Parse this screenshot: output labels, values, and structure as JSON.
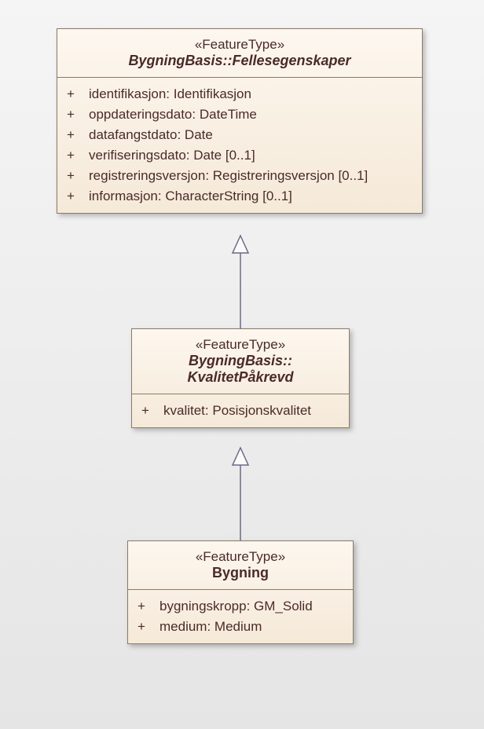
{
  "classes": {
    "fellesegenskaper": {
      "stereotype": "«FeatureType»",
      "name": "BygningBasis::Fellesegenskaper",
      "attributes": [
        {
          "vis": "+",
          "text": "identifikasjon: Identifikasjon"
        },
        {
          "vis": "+",
          "text": "oppdateringsdato: DateTime"
        },
        {
          "vis": "+",
          "text": "datafangstdato: Date"
        },
        {
          "vis": "+",
          "text": "verifiseringsdato: Date [0..1]"
        },
        {
          "vis": "+",
          "text": "registreringsversjon: Registreringsversjon [0..1]"
        },
        {
          "vis": "+",
          "text": "informasjon: CharacterString [0..1]"
        }
      ]
    },
    "kvalitetpakrevd": {
      "stereotype": "«FeatureType»",
      "name_line1": "BygningBasis::",
      "name_line2": "KvalitetPåkrevd",
      "attributes": [
        {
          "vis": "+",
          "text": "kvalitet: Posisjonskvalitet"
        }
      ]
    },
    "bygning": {
      "stereotype": "«FeatureType»",
      "name": "Bygning",
      "attributes": [
        {
          "vis": "+",
          "text": "bygningskropp: GM_Solid"
        },
        {
          "vis": "+",
          "text": "medium: Medium"
        }
      ]
    }
  }
}
